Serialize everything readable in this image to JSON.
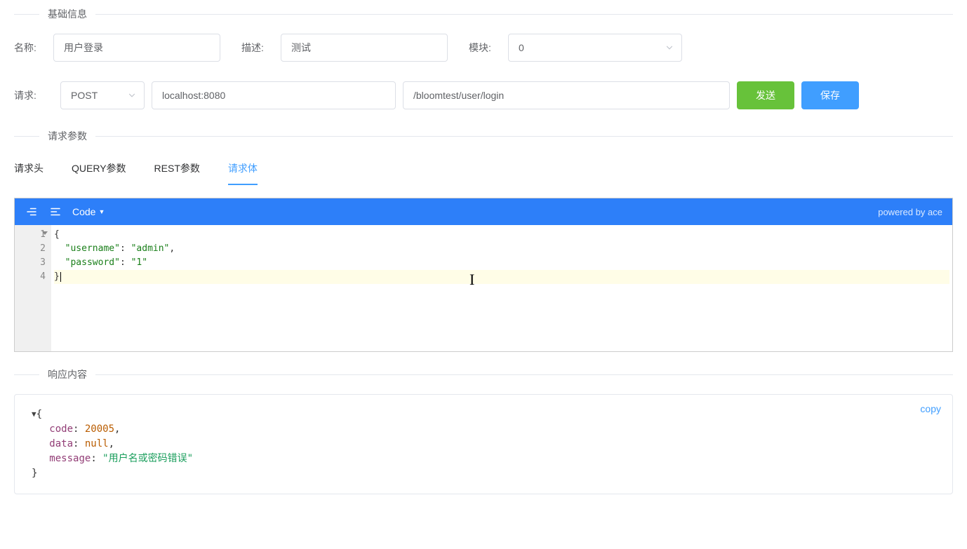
{
  "sections": {
    "basic_info": "基础信息",
    "request_params": "请求参数",
    "response_content": "响应内容"
  },
  "form": {
    "name_label": "名称:",
    "name_value": "用户登录",
    "desc_label": "描述:",
    "desc_value": "测试",
    "module_label": "模块:",
    "module_value": "0",
    "request_label": "请求:"
  },
  "request": {
    "method": "POST",
    "host": "localhost:8080",
    "path": "/bloomtest/user/login",
    "send_btn": "发送",
    "save_btn": "保存"
  },
  "tabs": {
    "headers": "请求头",
    "query": "QUERY参数",
    "rest": "REST参数",
    "body": "请求体"
  },
  "editor": {
    "code_label": "Code",
    "powered_by": "powered by ace",
    "gutter": [
      "1",
      "2",
      "3",
      "4"
    ],
    "body": {
      "line1_open": "{",
      "line2_key": "\"username\"",
      "line2_sep": ": ",
      "line2_val": "\"admin\"",
      "line2_end": ",",
      "line3_key": "\"password\"",
      "line3_sep": ": ",
      "line3_val": "\"1\"",
      "line4_close": "}"
    }
  },
  "response": {
    "copy": "copy",
    "open": "{",
    "code_key": "code",
    "code_val": "20005",
    "data_key": "data",
    "data_val": "null",
    "message_key": "message",
    "message_val": "\"用户名或密码错误\"",
    "close": "}"
  }
}
